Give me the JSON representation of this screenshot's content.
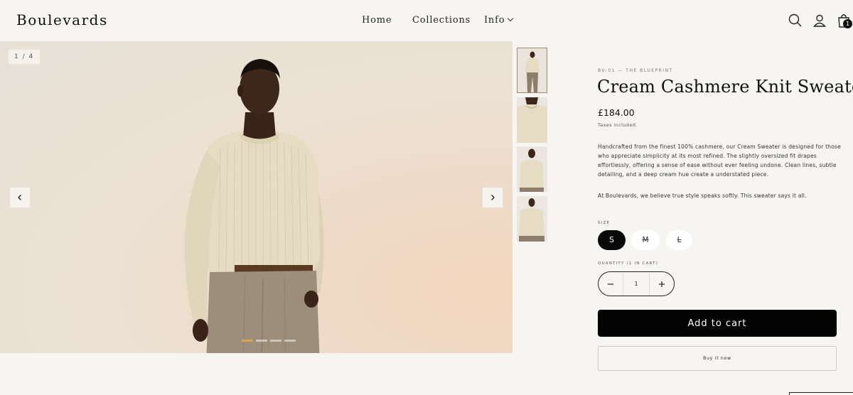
{
  "header": {
    "logo": "Boulevards",
    "nav": [
      {
        "label": "Home"
      },
      {
        "label": "Collections"
      },
      {
        "label": "Info"
      }
    ],
    "icons": [
      "search-icon",
      "account-icon",
      "cart-icon"
    ],
    "cart_count": "1"
  },
  "gallery": {
    "counter": "1 / 4",
    "current_slide": 1,
    "total_slides": 4,
    "thumbnails": [
      "full-body-front",
      "chest-detail",
      "half-body",
      "three-quarter"
    ]
  },
  "product": {
    "eyebrow": "BV-01 — THE BLUEPRINT",
    "title": "Cream Cashmere Knit Sweater",
    "price": "£184.00",
    "taxes": "Taxes included.",
    "description": "Handcrafted from the finest 100% cashmere, our Cream Sweater is designed for those who appreciate simplicity at its most refined. The slightly oversized fit drapes effortlessly, offering a sense of ease without ever feeling undone. Clean lines, subtle detailing, and a deep cream hue create a understated piece.",
    "description2": "At Boulevards, we believe true style speaks softly. This sweater says it all.",
    "size_label": "SIZE",
    "sizes": [
      {
        "label": "S",
        "selected": true,
        "available": true
      },
      {
        "label": "M",
        "selected": false,
        "available": false
      },
      {
        "label": "L",
        "selected": false,
        "available": false
      }
    ],
    "quantity_label": "QUANTITY (1 IN CART)",
    "quantity_value": "1",
    "add_to_cart": "Add to cart",
    "buy_now": "Buy it now"
  },
  "colors": {
    "background": "#f7f5f1",
    "primary_button": "#030303",
    "sweater": "#e6dcc3",
    "trousers": "#9c8e7a"
  }
}
